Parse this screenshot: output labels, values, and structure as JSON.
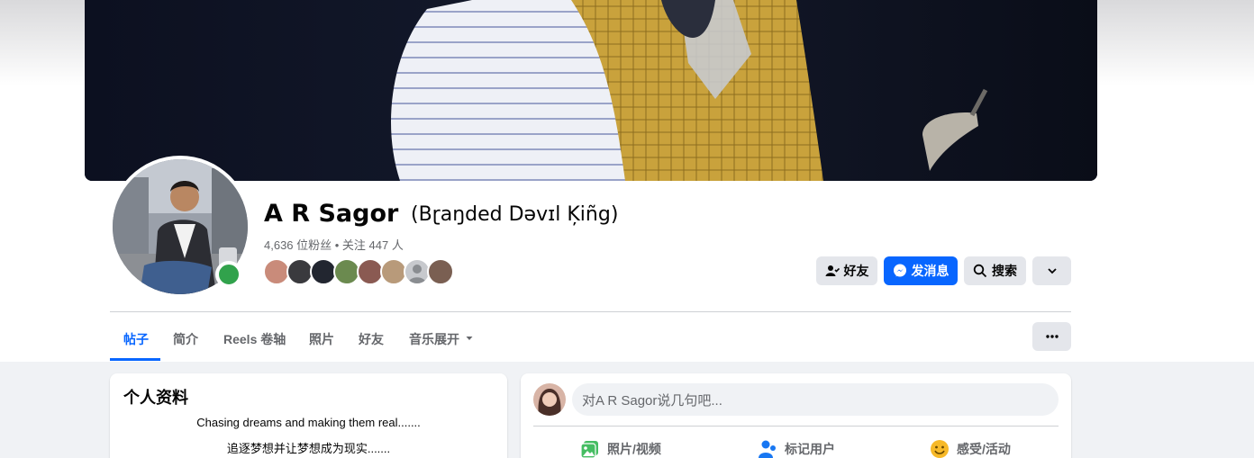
{
  "profile": {
    "name": "A R Sagor",
    "alt_name": "(Bɽaŋded Dəvɪl Ķiñg)",
    "stats": "4,636 位粉丝 • 关注 447 人",
    "online": true
  },
  "actions": {
    "friends_label": "好友",
    "message_label": "发消息",
    "search_label": "搜索"
  },
  "tabs": [
    {
      "label": "帖子",
      "active": true
    },
    {
      "label": "简介",
      "active": false
    },
    {
      "label": "Reels  卷轴",
      "active": false
    },
    {
      "label": "照片",
      "active": false
    },
    {
      "label": "好友",
      "active": false
    },
    {
      "label": "音乐展开",
      "active": false
    }
  ],
  "intro": {
    "title": "个人资料",
    "bio_lines": [
      "Chasing dreams and making them real.......",
      "追逐梦想并让梦想成为现实......."
    ]
  },
  "composer": {
    "placeholder": "对A R Sagor说几句吧...",
    "actions": [
      {
        "label": "照片/视频",
        "icon": "photo-video-icon"
      },
      {
        "label": "标记用户",
        "icon": "tag-people-icon"
      },
      {
        "label": "感受/活动",
        "icon": "feeling-activity-icon"
      }
    ]
  },
  "colors": {
    "accent": "#0866ff",
    "online": "#31a24c",
    "secondary_text": "#65676b",
    "button_gray": "#e4e6eb",
    "photo_icon": "#45bd62",
    "tag_icon": "#1877f2",
    "feeling_icon": "#f7b928"
  }
}
